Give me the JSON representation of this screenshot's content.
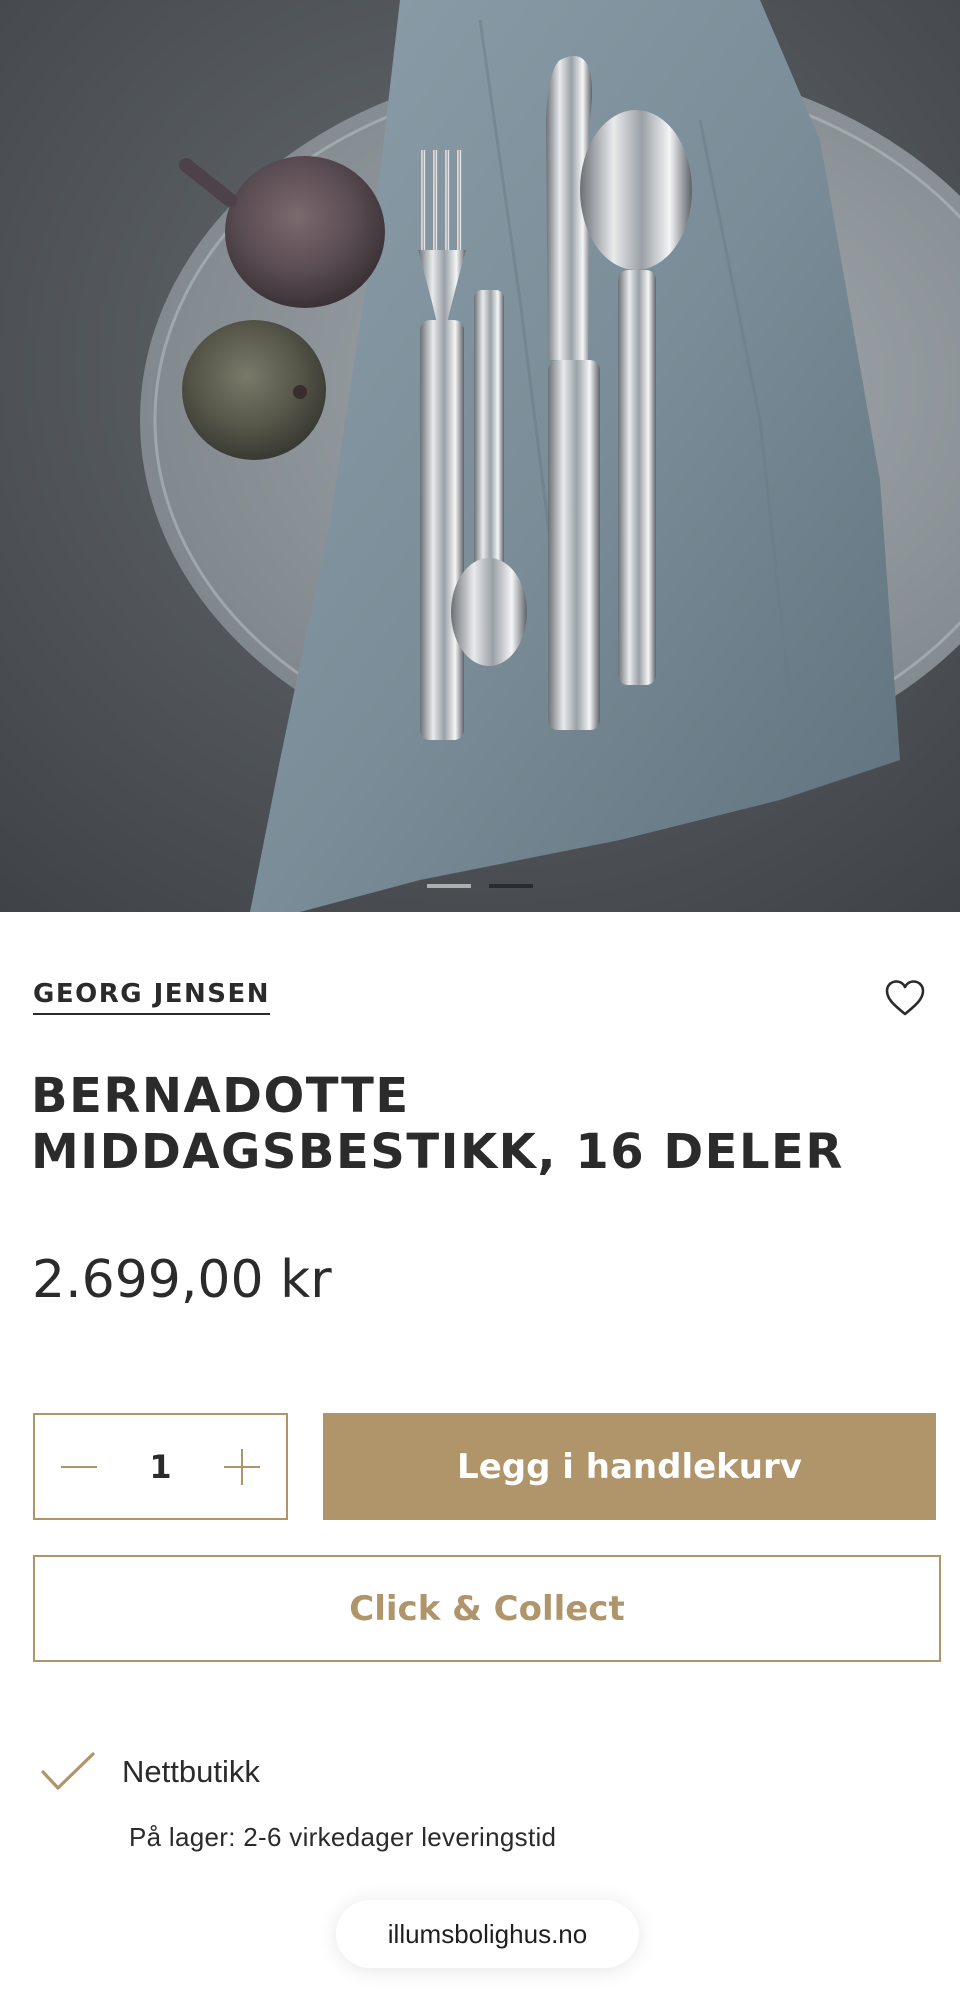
{
  "hero": {
    "image_icon": "cutlery-figs-photo",
    "carousel": {
      "count": 2,
      "active_index": 1
    }
  },
  "product": {
    "brand": "GEORG JENSEN",
    "title": "BERNADOTTE MIDDAGSBESTIKK, 16 DELER",
    "price": "2.699,00 kr",
    "favorite_icon": "heart-outline-icon"
  },
  "cart": {
    "quantity": "1",
    "decrement_icon": "minus-icon",
    "increment_icon": "plus-icon",
    "add_to_cart_label": "Legg i handlekurv",
    "click_collect_label": "Click & Collect"
  },
  "availability": {
    "icon": "checkmark-icon",
    "channel": "Nettbutikk",
    "detail": "På lager: 2-6 virkedager leveringstid"
  },
  "browser": {
    "url": "illumsbolighus.no"
  },
  "colors": {
    "accent": "#b0946a",
    "text": "#2b2b2b",
    "background": "#ffffff"
  }
}
